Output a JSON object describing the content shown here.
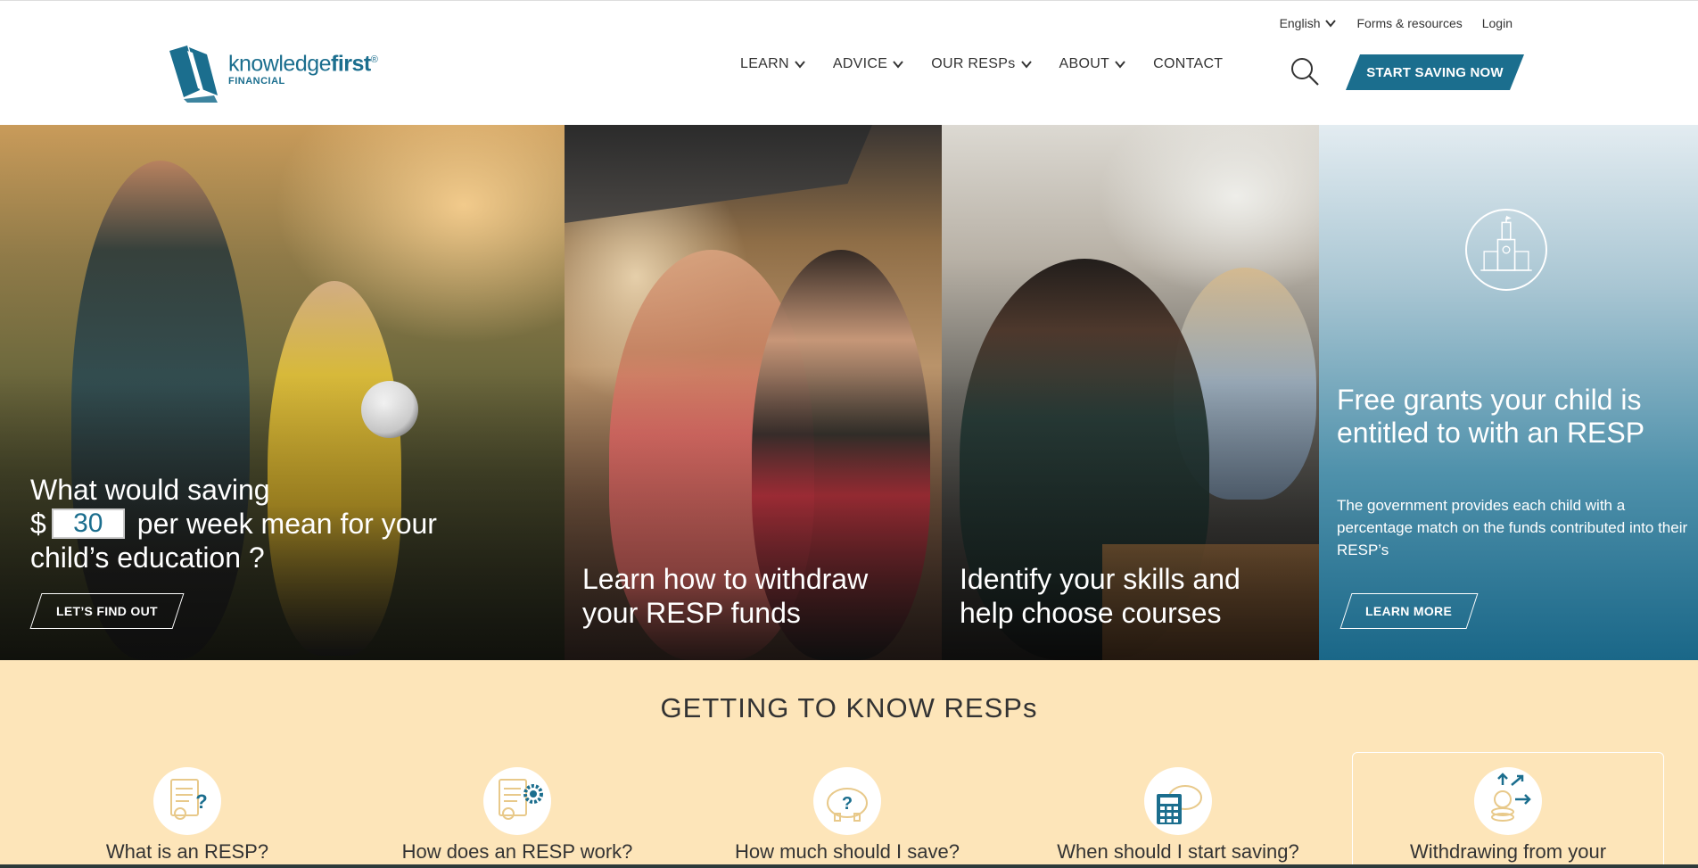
{
  "colors": {
    "brand": "#1b6e8e",
    "cream": "#fde5b9"
  },
  "header": {
    "logo": {
      "word_light": "knowledge",
      "word_bold": "first",
      "reg": "®",
      "sub": "FINANCIAL"
    },
    "utility_nav": [
      {
        "label": "English",
        "has_dropdown": true
      },
      {
        "label": "Forms & resources",
        "has_dropdown": false
      },
      {
        "label": "Login",
        "has_dropdown": false
      }
    ],
    "main_nav": [
      {
        "label": "LEARN",
        "has_dropdown": true
      },
      {
        "label": "ADVICE",
        "has_dropdown": true
      },
      {
        "label": "OUR RESPs",
        "has_dropdown": true
      },
      {
        "label": "ABOUT",
        "has_dropdown": true
      },
      {
        "label": "CONTACT",
        "has_dropdown": false
      }
    ],
    "search_icon": "search-icon",
    "cta": "START SAVING NOW"
  },
  "hero": {
    "panel1": {
      "line1": "What would saving",
      "currency": "$",
      "amount": "30",
      "line2_rest": "per week mean for your",
      "line3": "child’s education ?",
      "button": "LET’S FIND OUT"
    },
    "panel2": {
      "caption_l1": "Learn how to withdraw",
      "caption_l2": "your RESP funds"
    },
    "panel3": {
      "caption_l1": "Identify your skills and",
      "caption_l2": "help choose courses"
    },
    "panel4": {
      "icon": "parliament-icon",
      "title": "Free grants your child is entitled to with an RESP",
      "body": "The government provides each child with a percentage match on the funds contributed into their RESP’s",
      "button": "LEARN MORE"
    }
  },
  "getting_to_know": {
    "title": "GETTING TO KNOW RESPs",
    "cards": [
      {
        "label": "What is an RESP?",
        "icon": "document-question-icon"
      },
      {
        "label": "How does an RESP work?",
        "icon": "document-gear-icon"
      },
      {
        "label": "How much should I save?",
        "icon": "piggy-bank-question-icon"
      },
      {
        "label": "When should I start saving?",
        "icon": "calculator-piggy-icon"
      },
      {
        "label": "Withdrawing from your",
        "icon": "coins-arrows-icon"
      }
    ]
  }
}
